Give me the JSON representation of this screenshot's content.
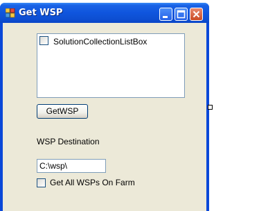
{
  "window": {
    "title": "Get WSP"
  },
  "listbox": {
    "items": [
      {
        "label": "SolutionCollectionListBox",
        "checked": false
      }
    ]
  },
  "get_wsp_button": {
    "label": "GetWSP"
  },
  "destination": {
    "label": "WSP Destination",
    "value": "C:\\wsp\\"
  },
  "get_all_checkbox": {
    "label": "Get All WSPs On Farm",
    "checked": false
  },
  "colors": {
    "titlebar": "#0f55dd",
    "client_background": "#ece9d8",
    "close_button": "#c94a24"
  }
}
